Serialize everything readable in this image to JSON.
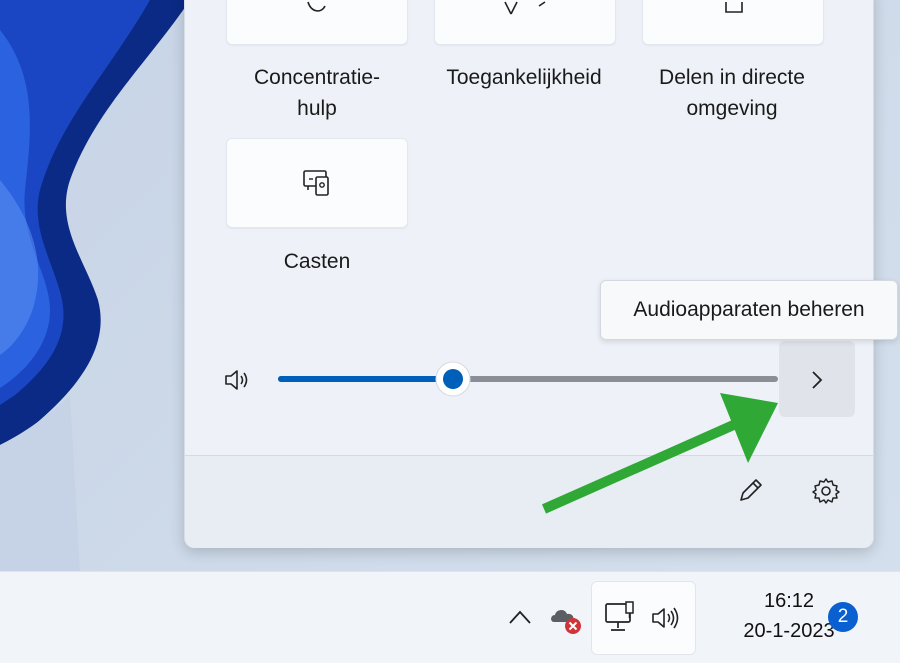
{
  "tiles": [
    {
      "label_line1": "Concentratie-",
      "label_line2": "hulp",
      "icon": "moon-icon"
    },
    {
      "label_line1": "Toegankelijkheid",
      "label_line2": "",
      "icon": "accessibility-icon"
    },
    {
      "label_line1": "Delen in directe",
      "label_line2": "omgeving",
      "icon": "nearby-share-icon"
    },
    {
      "label_line1": "Casten",
      "label_line2": "",
      "icon": "cast-icon"
    }
  ],
  "volume": {
    "icon": "speaker-icon",
    "level_percent": 35
  },
  "tooltip": {
    "text": "Audioapparaten beheren"
  },
  "footer": {
    "edit_icon": "pencil-icon",
    "settings_icon": "gear-icon"
  },
  "taskbar": {
    "time": "16:12",
    "date": "20-1-2023",
    "notification_count": "2",
    "tray_icons": [
      "chevron-up-icon",
      "onedrive-error-icon",
      "network-icon",
      "volume-icon"
    ]
  },
  "colors": {
    "accent": "#005fb8",
    "arrow": "#2fa836",
    "badge": "#0a5fd1"
  }
}
